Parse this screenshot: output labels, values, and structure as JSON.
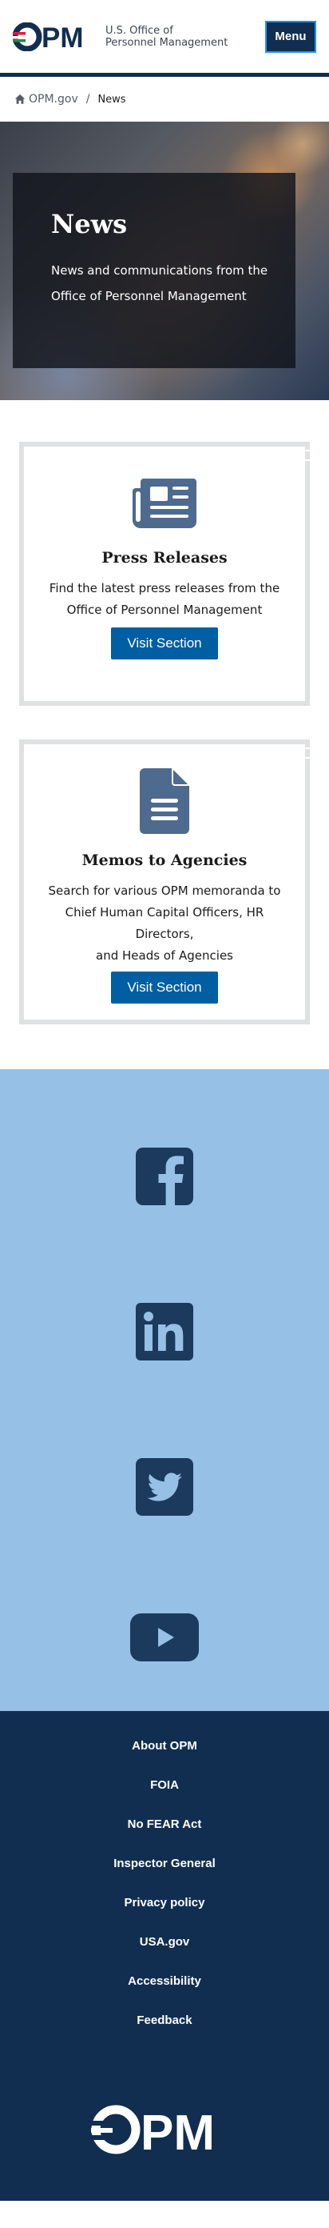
{
  "header": {
    "logo_text": "OPM",
    "agency_line1": "U.S. Office of",
    "agency_line2": "Personnel Management",
    "menu_label": "Menu"
  },
  "breadcrumb": {
    "home_label": "OPM.gov",
    "separator": "/",
    "current": "News"
  },
  "hero": {
    "title": "News",
    "desc_line1": "News and communications from the",
    "desc_line2": "Office of Personnel Management"
  },
  "cards": [
    {
      "icon": "newspaper-icon",
      "title": "Press Releases",
      "desc_lines": [
        "Find the latest press releases from the",
        "Office of Personnel Management"
      ],
      "button": "Visit Section"
    },
    {
      "icon": "document-icon",
      "title": "Memos to Agencies",
      "desc_lines": [
        "Search for various OPM memoranda to",
        "Chief Human Capital Officers, HR Directors,",
        "and Heads of Agencies"
      ],
      "button": "Visit Section"
    }
  ],
  "social": [
    {
      "name": "facebook-icon"
    },
    {
      "name": "linkedin-icon"
    },
    {
      "name": "twitter-icon"
    },
    {
      "name": "youtube-icon"
    }
  ],
  "footer": {
    "links": [
      "About OPM",
      "FOIA",
      "No FEAR Act",
      "Inspector General",
      "Privacy policy",
      "USA.gov",
      "Accessibility",
      "Feedback"
    ],
    "logo_text": "OPM"
  },
  "colors": {
    "navy": "#112e51",
    "primary_button": "#005ea2",
    "social_band": "#97c0e6",
    "icon_fill": "#4e6a8e",
    "social_icon": "#1c3a5e"
  }
}
